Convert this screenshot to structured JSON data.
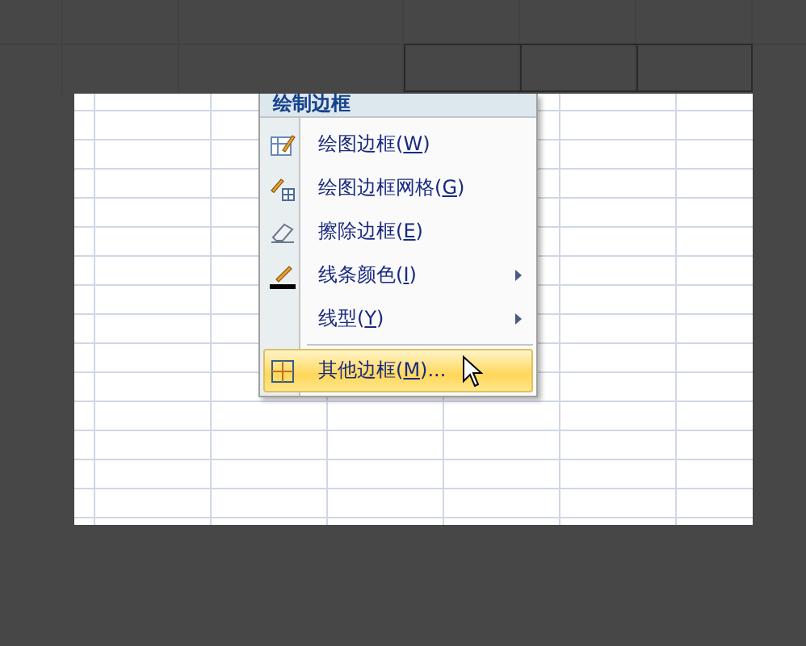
{
  "menu": {
    "heading": "绘制边框",
    "items": [
      {
        "kind": "draw-border",
        "text": "绘图边框(",
        "key": "W",
        "after": ")",
        "submenu": false,
        "selected": false
      },
      {
        "kind": "draw-grid",
        "text": "绘图边框网格(",
        "key": "G",
        "after": ")",
        "submenu": false,
        "selected": false
      },
      {
        "kind": "eraser",
        "text": "擦除边框(",
        "key": "E",
        "after": ")",
        "submenu": false,
        "selected": false
      },
      {
        "kind": "line-color",
        "text": "线条颜色(",
        "key": "I",
        "after": ")",
        "submenu": true,
        "selected": false
      },
      {
        "kind": "plain",
        "text": "线型(",
        "key": "Y",
        "after": ")",
        "submenu": true,
        "selected": false
      },
      {
        "kind": "borders",
        "text": "其他边框(",
        "key": "M",
        "after": ")...",
        "submenu": false,
        "selected": true,
        "separator_before": true
      }
    ]
  }
}
